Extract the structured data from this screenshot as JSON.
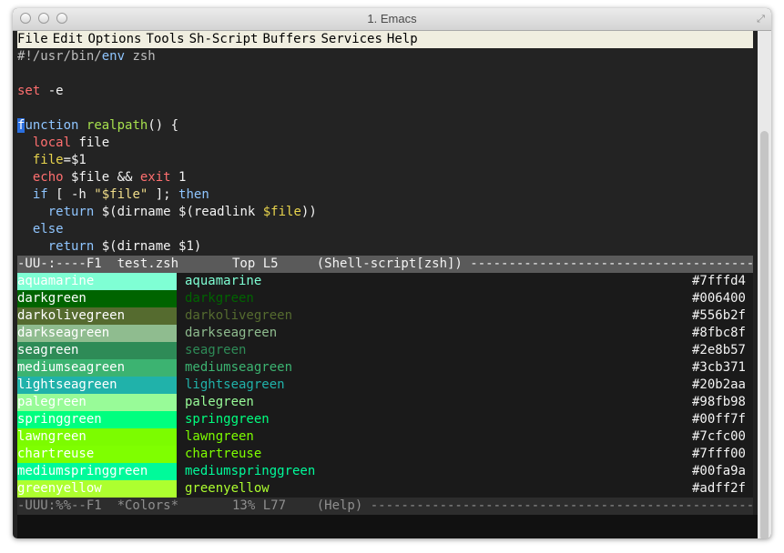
{
  "window": {
    "title": "1. Emacs"
  },
  "menu": [
    "File",
    "Edit",
    "Options",
    "Tools",
    "Sh-Script",
    "Buffers",
    "Services",
    "Help"
  ],
  "editor_lines": [
    [
      [
        "#!/usr/bin/",
        "#bdbdbd"
      ],
      [
        "env",
        "#8fc5ff"
      ],
      [
        " zsh",
        "#bdbdbd"
      ]
    ],
    [],
    [
      [
        "set",
        "#ff6f6f"
      ],
      [
        " -e",
        "#f3f3f3"
      ]
    ],
    [],
    [
      [
        "f",
        "#ffffff",
        "cursor"
      ],
      [
        "unction",
        "#8fc5ff"
      ],
      [
        " ",
        "#f3f3f3"
      ],
      [
        "realpath",
        "#a6e04d"
      ],
      [
        "() {",
        "#f3f3f3"
      ]
    ],
    [
      [
        "  ",
        "#f3f3f3"
      ],
      [
        "local",
        "#ff6f6f"
      ],
      [
        " file",
        "#f3f3f3"
      ]
    ],
    [
      [
        "  ",
        "#f3f3f3"
      ],
      [
        "file",
        "#e8d44d"
      ],
      [
        "=$1",
        "#f3f3f3"
      ]
    ],
    [
      [
        "  ",
        "#f3f3f3"
      ],
      [
        "echo",
        "#ff6f6f"
      ],
      [
        " $file && ",
        "#f3f3f3"
      ],
      [
        "exit",
        "#ff6f6f"
      ],
      [
        " 1",
        "#f3f3f3"
      ]
    ],
    [
      [
        "  ",
        "#f3f3f3"
      ],
      [
        "if",
        "#8fc5ff"
      ],
      [
        " [ -h ",
        "#f3f3f3"
      ],
      [
        "\"$file\"",
        "#f0dd8a"
      ],
      [
        " ]; ",
        "#f3f3f3"
      ],
      [
        "then",
        "#8fc5ff"
      ]
    ],
    [
      [
        "    ",
        "#f3f3f3"
      ],
      [
        "return",
        "#8fc5ff"
      ],
      [
        " $(dirname $(readlink ",
        "#f3f3f3"
      ],
      [
        "$file",
        "#e8d44d"
      ],
      [
        "))",
        "#f3f3f3"
      ]
    ],
    [
      [
        "  ",
        "#f3f3f3"
      ],
      [
        "else",
        "#8fc5ff"
      ]
    ],
    [
      [
        "    ",
        "#f3f3f3"
      ],
      [
        "return",
        "#8fc5ff"
      ],
      [
        " $(dirname $1)",
        "#f3f3f3"
      ]
    ]
  ],
  "modeline_top": "-UU-:----F1  test.zsh       Top L5     (Shell-script[zsh]) ----------------------------------------------------------------",
  "colors": [
    {
      "name": "aquamarine",
      "hex": "#7fffd4"
    },
    {
      "name": "darkgreen",
      "hex": "#006400"
    },
    {
      "name": "darkolivegreen",
      "hex": "#556b2f"
    },
    {
      "name": "darkseagreen",
      "hex": "#8fbc8f"
    },
    {
      "name": "seagreen",
      "hex": "#2e8b57"
    },
    {
      "name": "mediumseagreen",
      "hex": "#3cb371"
    },
    {
      "name": "lightseagreen",
      "hex": "#20b2aa"
    },
    {
      "name": "palegreen",
      "hex": "#98fb98"
    },
    {
      "name": "springgreen",
      "hex": "#00ff7f"
    },
    {
      "name": "lawngreen",
      "hex": "#7cfc00"
    },
    {
      "name": "chartreuse",
      "hex": "#7fff00"
    },
    {
      "name": "mediumspringgreen",
      "hex": "#00fa9a"
    },
    {
      "name": "greenyellow",
      "hex": "#adff2f"
    }
  ],
  "modeline_bottom": "-UUU:%%--F1  *Colors*       13% L77    (Help) ---------------------------------------------------------------------"
}
